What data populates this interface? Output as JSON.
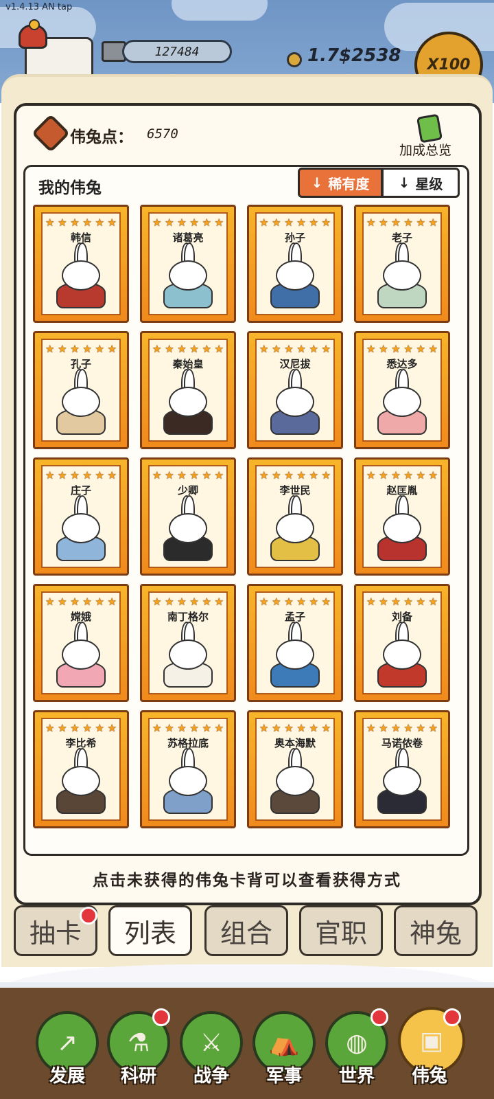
{
  "version": "v1.4.13 AN tap",
  "resources": {
    "silver": "127484",
    "gold": "1.7$2538",
    "multiplier_button": "X100"
  },
  "panel": {
    "points_label": "伟兔点：",
    "points_value": "6570",
    "bonus_label": "加成总览",
    "list_title": "我的伟兔",
    "sort_rarity": "稀有度",
    "sort_star": "星级",
    "sort_arrow": "↓",
    "star_glyph": "★",
    "hint": "点击未获得的伟兔卡背可以查看获得方式"
  },
  "cards": [
    {
      "name": "韩信",
      "ear": "#ffffff",
      "body": "#b83a2e"
    },
    {
      "name": "诸葛亮",
      "ear": "#ffffff",
      "body": "#8cc0cf"
    },
    {
      "name": "孙子",
      "ear": "#ffffff",
      "body": "#3f6fa6"
    },
    {
      "name": "老子",
      "ear": "#ffffff",
      "body": "#bfd6c0"
    },
    {
      "name": "孔子",
      "ear": "#ffffff",
      "body": "#e2c9a0"
    },
    {
      "name": "秦始皇",
      "ear": "#ffffff",
      "body": "#3b2a24"
    },
    {
      "name": "汉尼拔",
      "ear": "#ffffff",
      "body": "#5a6a9a"
    },
    {
      "name": "悉达多",
      "ear": "#ffffff",
      "body": "#f0a9a9"
    },
    {
      "name": "庄子",
      "ear": "#ffffff",
      "body": "#8fb6da"
    },
    {
      "name": "少卿",
      "ear": "#ffffff",
      "body": "#2b2b2b"
    },
    {
      "name": "李世民",
      "ear": "#ffffff",
      "body": "#e3c045"
    },
    {
      "name": "赵匡胤",
      "ear": "#ffffff",
      "body": "#b8322e"
    },
    {
      "name": "嫦娥",
      "ear": "#ffffff",
      "body": "#f2a7b4"
    },
    {
      "name": "南丁格尔",
      "ear": "#ffffff",
      "body": "#f6f1e6"
    },
    {
      "name": "孟子",
      "ear": "#ffffff",
      "body": "#3d7ab8"
    },
    {
      "name": "刘备",
      "ear": "#ffffff",
      "body": "#c0392b"
    },
    {
      "name": "李比希",
      "ear": "#ffffff",
      "body": "#5a4636"
    },
    {
      "name": "苏格拉底",
      "ear": "#ffffff",
      "body": "#7fa0c9"
    },
    {
      "name": "奥本海默",
      "ear": "#ffffff",
      "body": "#5b4a3c"
    },
    {
      "name": "马诺侬卷",
      "ear": "#ffffff",
      "body": "#2b2b36"
    }
  ],
  "tabs": [
    {
      "label": "抽卡",
      "dot": true,
      "active": false
    },
    {
      "label": "列表",
      "dot": false,
      "active": true
    },
    {
      "label": "组合",
      "dot": false,
      "active": false
    },
    {
      "label": "官职",
      "dot": false,
      "active": false
    },
    {
      "label": "神兔",
      "dot": false,
      "active": false
    }
  ],
  "nav": [
    {
      "label": "发展",
      "glyph": "↗",
      "dot": false,
      "active": false
    },
    {
      "label": "科研",
      "glyph": "⚗",
      "dot": true,
      "active": false
    },
    {
      "label": "战争",
      "glyph": "⚔",
      "dot": false,
      "active": false
    },
    {
      "label": "军事",
      "glyph": "⛺",
      "dot": false,
      "active": false
    },
    {
      "label": "世界",
      "glyph": "◍",
      "dot": true,
      "active": false
    },
    {
      "label": "伟兔",
      "glyph": "▣",
      "dot": true,
      "active": true
    }
  ],
  "colors": {
    "card_gold": "#f7b52a",
    "sort_active": "#e8723a",
    "nav_green": "#5aa63a",
    "nav_active": "#f5c24a",
    "notification": "#e2353c"
  }
}
